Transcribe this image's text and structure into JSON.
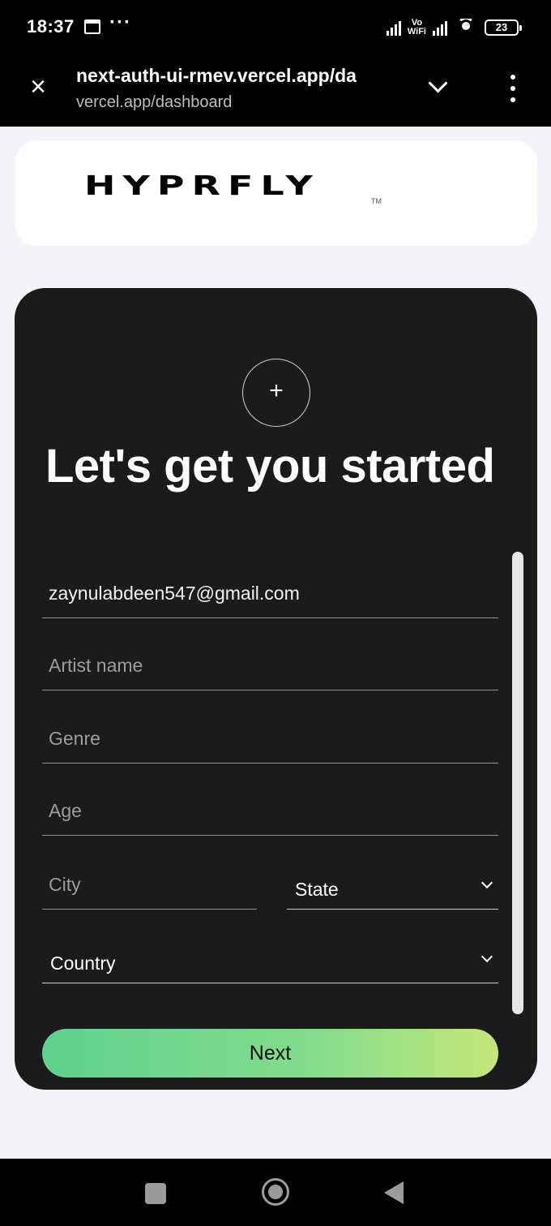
{
  "status_bar": {
    "time": "18:37",
    "more": "···",
    "vowifi_top": "Vo",
    "vowifi_bottom": "WiFi",
    "battery": "23"
  },
  "browser": {
    "url_main": "next-auth-ui-rmev.vercel.app/da",
    "url_sub": "vercel.app/dashboard"
  },
  "brand": {
    "logo_text": "HYPRFLY",
    "tm": "TM"
  },
  "form": {
    "title": "Let's get you started",
    "add_symbol": "+",
    "email_value": "zaynulabdeen547@gmail.com",
    "artist_placeholder": "Artist name",
    "genre_placeholder": "Genre",
    "age_placeholder": "Age",
    "city_placeholder": "City",
    "state_label": "State",
    "country_label": "Country",
    "next_label": "Next"
  },
  "colors": {
    "card_bg": "#1b1b1b",
    "gradient_start": "#5fd18e",
    "gradient_end": "#c5e77a"
  }
}
